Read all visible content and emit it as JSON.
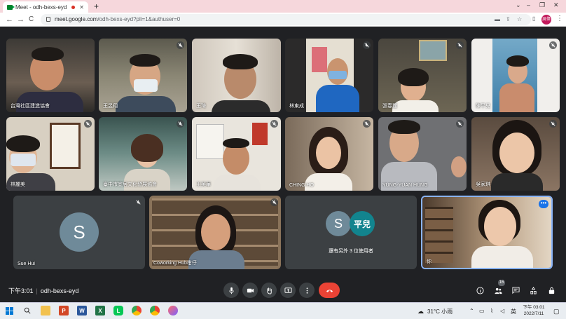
{
  "browser": {
    "tab_title": "Meet - odh-bexs-eyd",
    "tab_close": "✕",
    "new_tab": "+",
    "window_controls": [
      "⌄",
      "–",
      "❐",
      "✕"
    ],
    "url_host": "meet.google.com",
    "url_path": "/odh-bexs-eyd?pli=1&authuser=0",
    "profile_initials": "吳偉",
    "nav_back": "←",
    "nav_forward": "→",
    "nav_reload": "C"
  },
  "participants": [
    {
      "name": "台灣社區建造協會",
      "muted": false
    },
    {
      "name": "王昱翔",
      "muted": true
    },
    {
      "name": "王琦",
      "muted": false
    },
    {
      "name": "林東成",
      "muted": true
    },
    {
      "name": "張春麗",
      "muted": true
    },
    {
      "name": "陳平兒",
      "muted": true
    },
    {
      "name": "林麗美",
      "muted": true
    },
    {
      "name": "臺中市宜居文化發展協會",
      "muted": true
    },
    {
      "name": "王英華",
      "muted": true
    },
    {
      "name": "CHING HO",
      "muted": true
    },
    {
      "name": "YUNG-YUAN HUNG",
      "muted": true
    },
    {
      "name": "吳家琪",
      "muted": true
    },
    {
      "name": "Sue Hui",
      "muted": true,
      "avatar_letter": "S"
    },
    {
      "name": "Coworking Hub柑仔",
      "muted": true
    },
    {
      "name": "還有另外 3 位使用者",
      "muted": false,
      "avatar_letters": [
        "S",
        "平兒"
      ]
    },
    {
      "name": "你",
      "muted": false
    }
  ],
  "colors": {
    "meet_bg": "#202124",
    "tile_bg": "#3c4043",
    "avatar_sue": "#6f8a99",
    "avatar_other_s": "#6f8a99",
    "avatar_other_p": "#12848e",
    "end_call": "#ea4335",
    "self_border": "#8ab4f8"
  },
  "bottom": {
    "time": "下午3:01",
    "separator": "|",
    "meeting_code": "odh-bexs-eyd",
    "participant_count": "16"
  },
  "icons": {
    "controls": [
      "mic-icon",
      "camera-icon",
      "raise-hand-icon",
      "present-icon",
      "more-options-icon",
      "end-call-icon"
    ],
    "right": [
      "info-icon",
      "people-icon",
      "chat-icon",
      "activities-icon",
      "lock-icon"
    ]
  },
  "taskbar": {
    "weather": "31°C 小雨",
    "ime": "英",
    "clock_time": "下午 03:01",
    "clock_date": "2022/7/11"
  }
}
